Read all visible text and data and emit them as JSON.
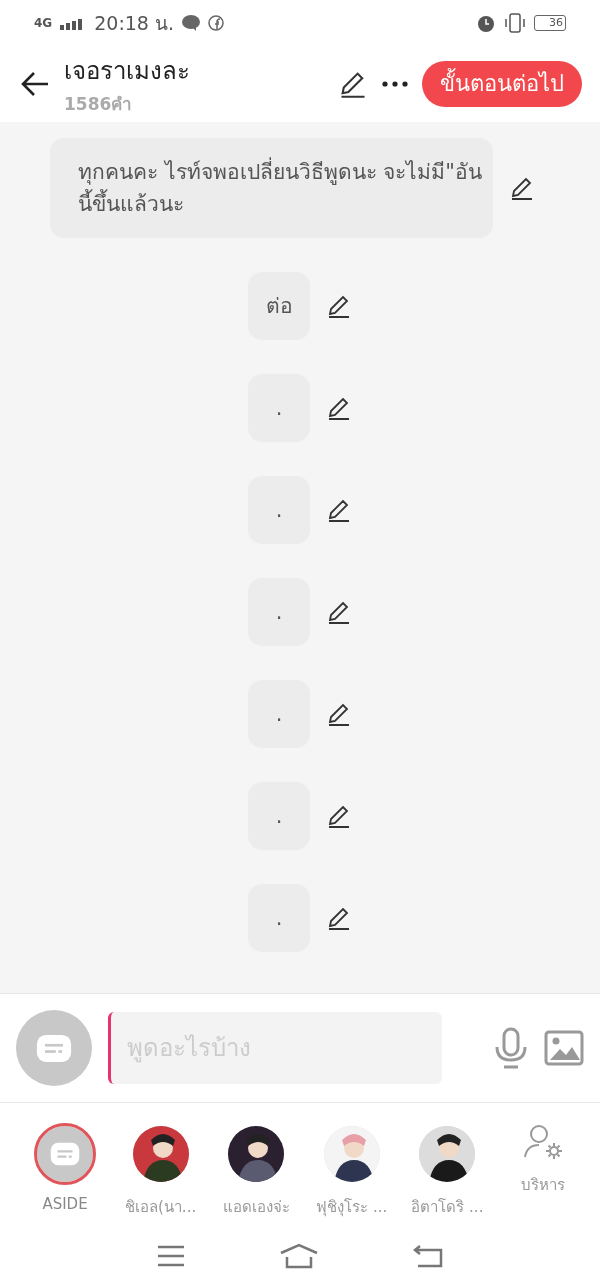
{
  "status_bar": {
    "network": "4G",
    "time": "20:18 น.",
    "battery": "36"
  },
  "header": {
    "title": "เจอราเมงละ",
    "word_count": "1586คำ",
    "next_button": "ขั้นตอนต่อไป"
  },
  "messages": [
    {
      "kind": "narration",
      "text": "ทุกคนคะ ไรท์จพอเปลี่ยนวิธีพูดนะ จะไม่มี\"อันนี้ขึ้นแล้วนะ"
    },
    {
      "kind": "line",
      "text": "ต่อ"
    },
    {
      "kind": "line",
      "text": "."
    },
    {
      "kind": "line",
      "text": "."
    },
    {
      "kind": "line",
      "text": "."
    },
    {
      "kind": "line",
      "text": "."
    },
    {
      "kind": "line",
      "text": "."
    },
    {
      "kind": "line",
      "text": "."
    }
  ],
  "composer": {
    "placeholder": "พูดอะไรบ้าง"
  },
  "characters": [
    {
      "kind": "aside",
      "name": "ASIDE",
      "selected": true
    },
    {
      "kind": "character",
      "name": "ชิเอล(นา...",
      "selected": false
    },
    {
      "kind": "character",
      "name": "แอดเองจ่ะ",
      "selected": false
    },
    {
      "kind": "character",
      "name": "ฟุชิงุโระ ...",
      "selected": false
    },
    {
      "kind": "character",
      "name": "อิตาโดริ ...",
      "selected": false
    },
    {
      "kind": "manage",
      "name": "บริหาร",
      "selected": false
    }
  ]
}
